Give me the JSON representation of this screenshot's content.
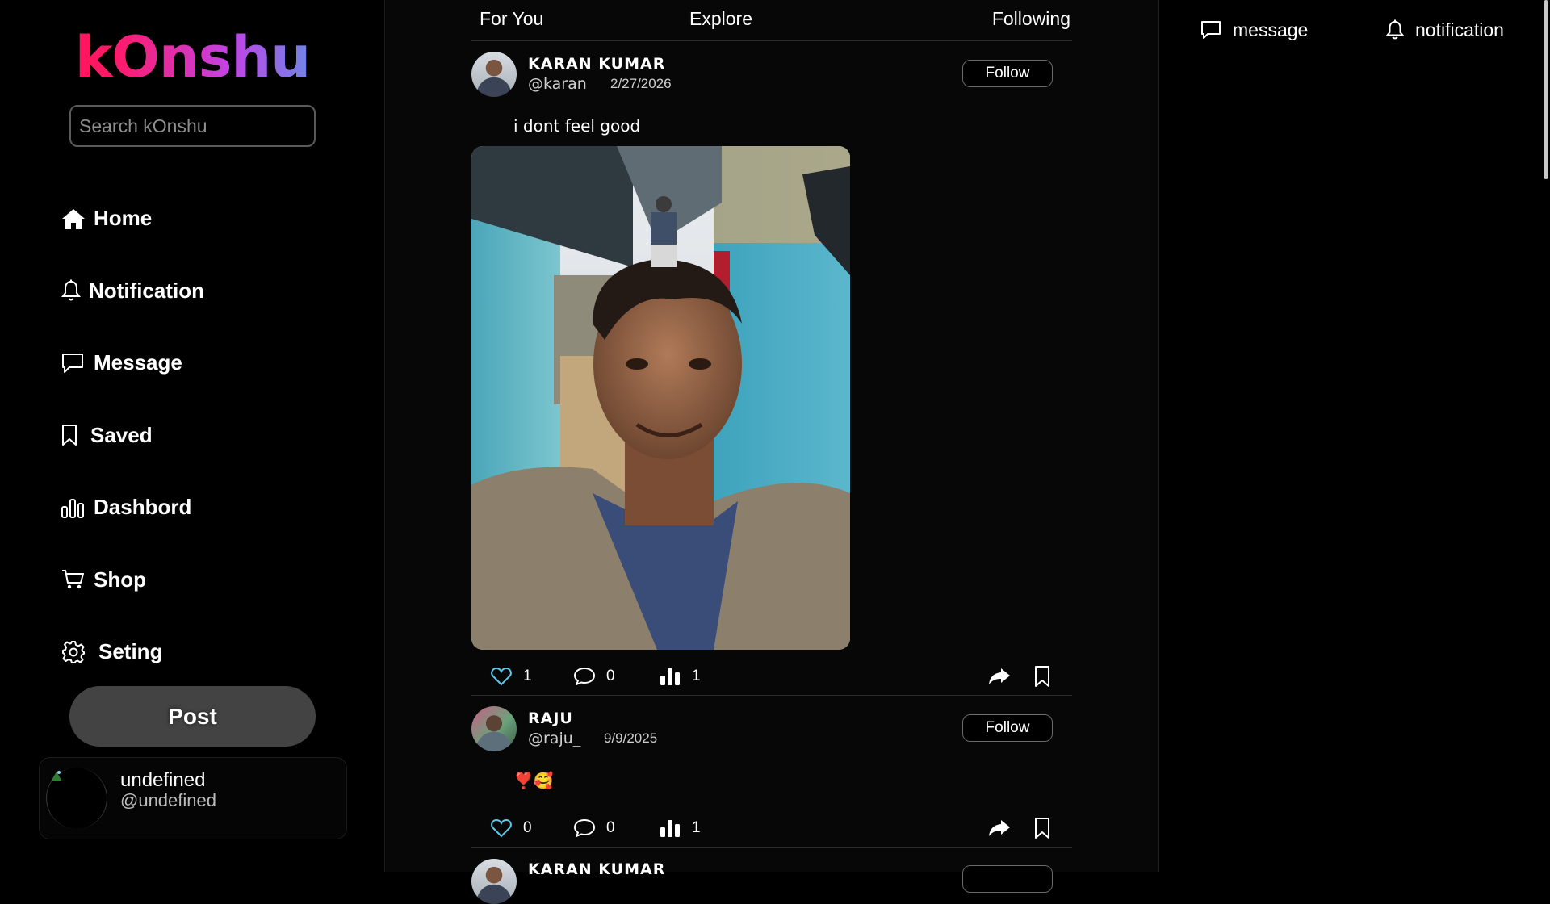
{
  "app": {
    "logo": "kOnshu",
    "search_placeholder": "Search kOnshu"
  },
  "nav": [
    {
      "label": "Home",
      "icon": "home-icon"
    },
    {
      "label": "Notification",
      "icon": "bell-icon"
    },
    {
      "label": "Message",
      "icon": "message-icon"
    },
    {
      "label": "Saved",
      "icon": "bookmark-icon"
    },
    {
      "label": "Dashbord",
      "icon": "bar-chart-icon"
    },
    {
      "label": "Shop",
      "icon": "cart-icon"
    },
    {
      "label": "Seting",
      "icon": "gear-icon"
    }
  ],
  "post_button": "Post",
  "current_user": {
    "name": "undefined",
    "handle": "@undefined"
  },
  "tabs": [
    "For You",
    "Explore",
    "Following"
  ],
  "posts": [
    {
      "name": "KARAN KUMAR",
      "handle": "@karan",
      "date": "2/27/2026",
      "follow": "Follow",
      "text": "i dont feel good",
      "has_image": true,
      "likes": "1",
      "comments": "0",
      "views": "1"
    },
    {
      "name": "RAJU",
      "handle": "@raju_",
      "date": "9/9/2025",
      "follow": "Follow",
      "text": "❣️🥰",
      "has_image": false,
      "likes": "0",
      "comments": "0",
      "views": "1"
    },
    {
      "name": "KARAN KUMAR"
    }
  ],
  "right_panel": {
    "message": "message",
    "notification": "notification"
  },
  "colors": {
    "background": "#000000",
    "feed_background": "#070707",
    "post_button": "#434343",
    "like_icon": "#5ec8e8",
    "logo_gradient": [
      "#ff0a44",
      "#c044e6",
      "#22c4e8"
    ]
  }
}
